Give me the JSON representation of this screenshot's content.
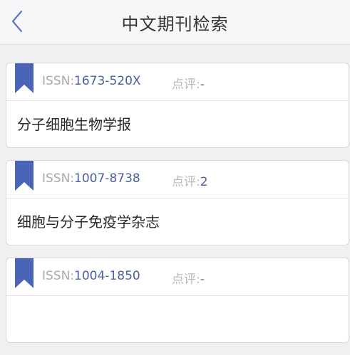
{
  "header": {
    "title": "中文期刊检索"
  },
  "labels": {
    "issn": "ISSN:",
    "rating": "点评:"
  },
  "journals": [
    {
      "issn": "1673-520X",
      "rating": "-",
      "name": "分子细胞生物学报"
    },
    {
      "issn": "1007-8738",
      "rating": "2",
      "name": "细胞与分子免疫学杂志"
    },
    {
      "issn": "1004-1850",
      "rating": "-",
      "name": ""
    }
  ],
  "colors": {
    "accent": "#4a64b8",
    "value": "#4a5f9a",
    "background": "#f0f0f3"
  },
  "icons": {
    "back": "chevron-left-icon",
    "bookmark": "bookmark-icon"
  }
}
